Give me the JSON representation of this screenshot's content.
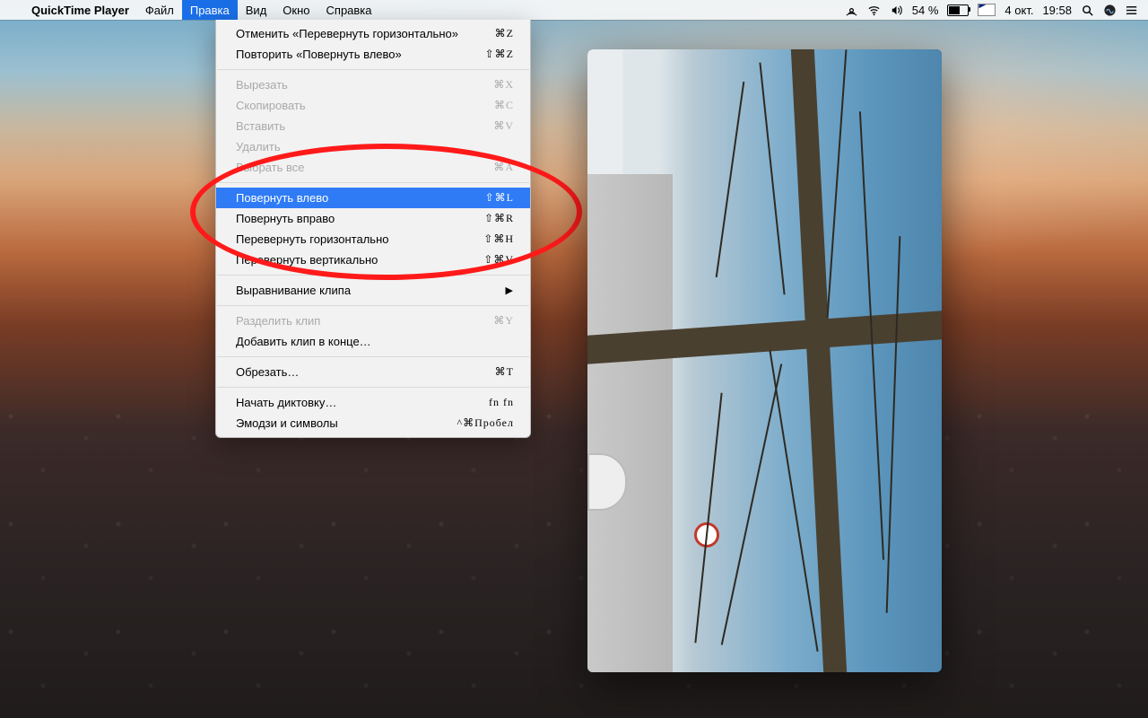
{
  "menubar": {
    "apple_icon": "apple-logo-icon",
    "app_name": "QuickTime Player",
    "items": [
      "Файл",
      "Правка",
      "Вид",
      "Окно",
      "Справка"
    ],
    "active_index": 1,
    "status": {
      "battery_pct": "54 %",
      "battery_icon": "battery-icon",
      "lang_flag": "GB",
      "date": "4 окт.",
      "time": "19:58",
      "icons": [
        "airdrop-icon",
        "wifi-icon",
        "volume-icon",
        "search-icon",
        "siri-icon",
        "control-center-icon"
      ]
    }
  },
  "dropdown": {
    "groups": [
      [
        {
          "label": "Отменить «Перевернуть горизонтально»",
          "shortcut": "⌘Z",
          "disabled": false
        },
        {
          "label": "Повторить «Повернуть влево»",
          "shortcut": "⇧⌘Z",
          "disabled": false
        }
      ],
      [
        {
          "label": "Вырезать",
          "shortcut": "⌘X",
          "disabled": true
        },
        {
          "label": "Скопировать",
          "shortcut": "⌘C",
          "disabled": true
        },
        {
          "label": "Вставить",
          "shortcut": "⌘V",
          "disabled": true
        },
        {
          "label": "Удалить",
          "shortcut": "",
          "disabled": true
        },
        {
          "label": "Выбрать все",
          "shortcut": "⌘A",
          "disabled": true
        }
      ],
      [
        {
          "label": "Повернуть влево",
          "shortcut": "⇧⌘L",
          "disabled": false,
          "hover": true
        },
        {
          "label": "Повернуть вправо",
          "shortcut": "⇧⌘R",
          "disabled": false
        },
        {
          "label": "Перевернуть горизонтально",
          "shortcut": "⇧⌘H",
          "disabled": false
        },
        {
          "label": "Перевернуть вертикально",
          "shortcut": "⇧⌘V",
          "disabled": false
        }
      ],
      [
        {
          "label": "Выравнивание клипа",
          "shortcut": "",
          "disabled": false,
          "submenu": true
        }
      ],
      [
        {
          "label": "Разделить клип",
          "shortcut": "⌘Y",
          "disabled": true
        },
        {
          "label": "Добавить клип в конце…",
          "shortcut": "",
          "disabled": false
        }
      ],
      [
        {
          "label": "Обрезать…",
          "shortcut": "⌘T",
          "disabled": false
        }
      ],
      [
        {
          "label": "Начать диктовку…",
          "shortcut": "fn fn",
          "disabled": false
        },
        {
          "label": "Эмодзи и символы",
          "shortcut": "^⌘Пробел",
          "disabled": false
        }
      ]
    ]
  },
  "annotation": {
    "shape": "ellipse",
    "color": "#ff1a1a"
  },
  "video_window": {
    "content_desc": "rotated-video-frame"
  }
}
